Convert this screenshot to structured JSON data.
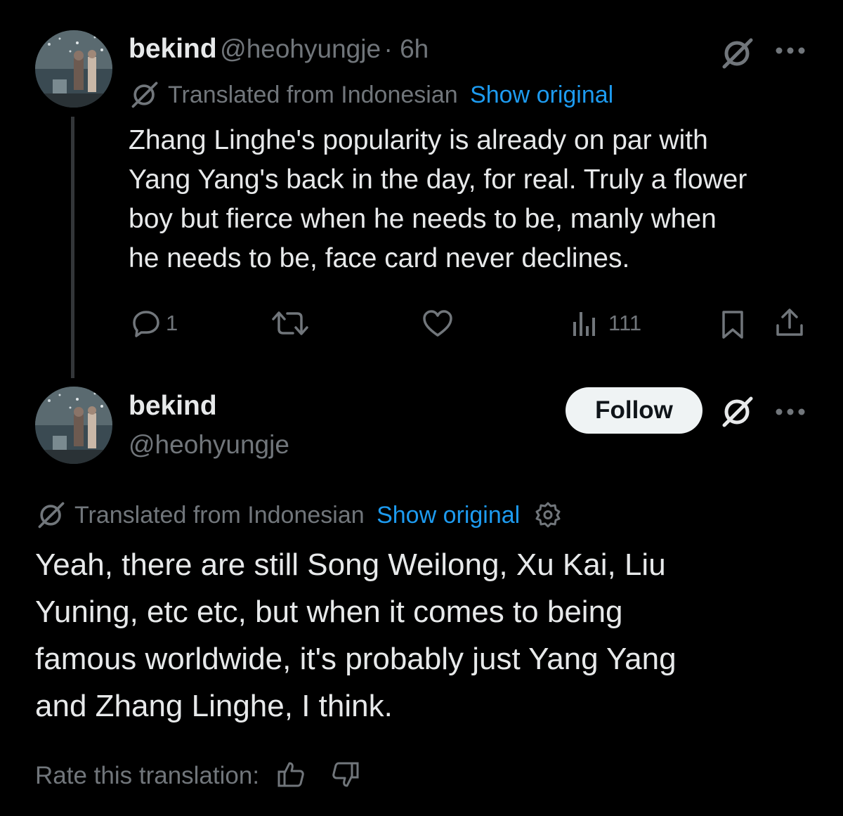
{
  "tweet1": {
    "display_name": "bekind",
    "handle": "@heohyungje",
    "time": "· 6h",
    "translated_label": "Translated from Indonesian",
    "show_original": "Show original",
    "text_lines": [
      "Zhang Linghe's popularity is already on par with",
      "Yang Yang's back in the day, for real. Truly a flower",
      "boy but fierce when he needs to be, manly when",
      "he needs to be, face card never declines."
    ],
    "reply_count": "1",
    "retweet_count": "",
    "like_count": "",
    "view_count": "111"
  },
  "tweet2": {
    "display_name": "bekind",
    "handle": "@heohyungje",
    "follow_label": "Follow",
    "translated_label": "Translated from Indonesian",
    "show_original": "Show original",
    "text_lines": [
      "Yeah, there are still Song Weilong, Xu Kai, Liu",
      "Yuning, etc etc, but when it comes to being",
      "famous worldwide, it's probably just Yang Yang",
      "and Zhang Linghe, I think."
    ],
    "rate_label": "Rate this translation:"
  },
  "icons": {
    "grok": "grok-icon",
    "more": "more-icon",
    "reply": "reply-icon",
    "retweet": "retweet-icon",
    "like": "like-icon",
    "views": "views-icon",
    "bookmark": "bookmark-icon",
    "share": "share-icon",
    "settings": "settings-icon",
    "thumbs_up": "thumbs-up-icon",
    "thumbs_down": "thumbs-down-icon"
  },
  "colors": {
    "background": "#000000",
    "text": "#e7e9ea",
    "secondary": "#71767b",
    "link": "#1d9bf0",
    "follow_bg": "#eff3f4"
  }
}
